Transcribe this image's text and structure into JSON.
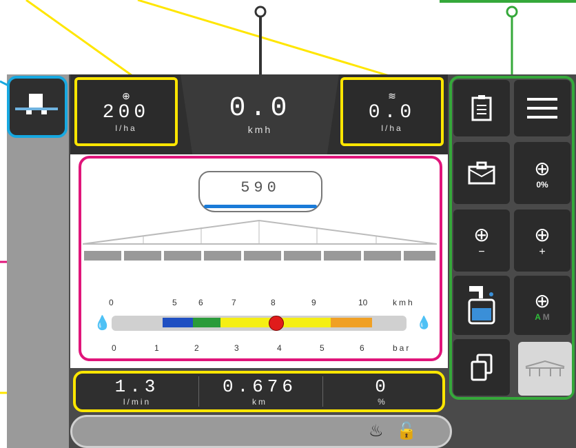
{
  "top": {
    "rate_set": {
      "value": "200",
      "unit": "l/ha"
    },
    "speed": {
      "value": "0.0",
      "unit": "kmh"
    },
    "rate_actual": {
      "value": "0.0",
      "unit": "l/ha"
    }
  },
  "tank": {
    "volume": "590"
  },
  "speed_scale": {
    "ticks": [
      "0",
      "5",
      "6",
      "7",
      "8",
      "9",
      "10"
    ],
    "unit": "kmh"
  },
  "pressure_scale": {
    "ticks": [
      "0",
      "1",
      "2",
      "3",
      "4",
      "5",
      "6"
    ],
    "unit": "bar"
  },
  "bottom": {
    "flow": {
      "value": "1.3",
      "unit": "l/min"
    },
    "distance": {
      "value": "0.676",
      "unit": "km"
    },
    "percent": {
      "value": "0",
      "unit": "%"
    }
  },
  "right_panel": {
    "target_percent": "0%",
    "minus_label": "−",
    "plus_label": "+",
    "auto_label": "A",
    "manual_label": "M"
  },
  "colors": {
    "yellow": "#ffe600",
    "magenta": "#e0157a",
    "green": "#35a83a",
    "blue": "#17a8e0"
  }
}
